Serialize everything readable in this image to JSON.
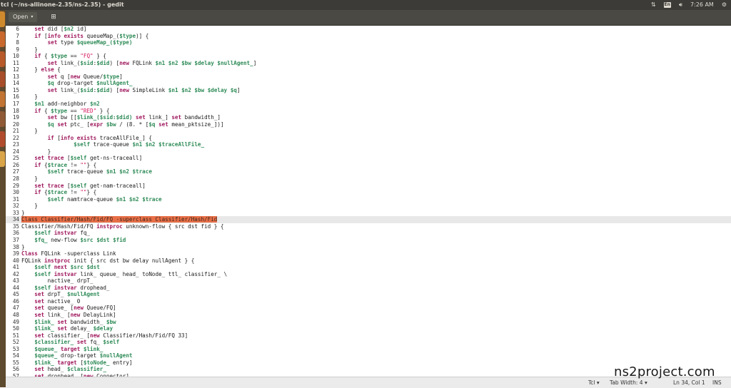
{
  "window": {
    "title": "tcl (~/ns-allinone-2.35/ns-2.35) - gedit",
    "tray": {
      "keyboard_layout": "En",
      "volume_icon": "speaker-icon",
      "time": "7:26 AM"
    }
  },
  "header": {
    "open_label": "Open",
    "new_icon": "new-document-icon"
  },
  "editor": {
    "lines": [
      {
        "n": "6",
        "t": "    set did [$n2 id]"
      },
      {
        "n": "7",
        "t": "    if [info exists queueMap_($type)] {"
      },
      {
        "n": "8",
        "t": "        set type $queueMap_($type)"
      },
      {
        "n": "9",
        "t": "    }"
      },
      {
        "n": "10",
        "t": "    if { $type == \"FQ\" } {"
      },
      {
        "n": "11",
        "t": "        set link_($sid:$did) [new FQLink $n1 $n2 $bw $delay $nullAgent_]"
      },
      {
        "n": "12",
        "t": "    } else {"
      },
      {
        "n": "13",
        "t": "        set q [new Queue/$type]"
      },
      {
        "n": "14",
        "t": "        $q drop-target $nullAgent_"
      },
      {
        "n": "15",
        "t": "        set link_($sid:$did) [new SimpleLink $n1 $n2 $bw $delay $q]"
      },
      {
        "n": "16",
        "t": "    }"
      },
      {
        "n": "17",
        "t": "    $n1 add-neighbor $n2"
      },
      {
        "n": "18",
        "t": "    if { $type == \"RED\" } {"
      },
      {
        "n": "19",
        "t": "        set bw [[$link_($sid:$did) set link_] set bandwidth_]"
      },
      {
        "n": "20",
        "t": "        $q set ptc_ [expr $bw / (8. * [$q set mean_pktsize_])]"
      },
      {
        "n": "21",
        "t": "    }"
      },
      {
        "n": "22",
        "t": "        if [info exists traceAllFile_] {"
      },
      {
        "n": "23",
        "t": "                $self trace-queue $n1 $n2 $traceAllFile_"
      },
      {
        "n": "24",
        "t": "        }"
      },
      {
        "n": "25",
        "t": "    set trace [$self get-ns-traceall]"
      },
      {
        "n": "26",
        "t": "    if {$trace != \"\"} {"
      },
      {
        "n": "27",
        "t": "        $self trace-queue $n1 $n2 $trace"
      },
      {
        "n": "28",
        "t": "    }"
      },
      {
        "n": "29",
        "t": "    set trace [$self get-nam-traceall]"
      },
      {
        "n": "30",
        "t": "    if {$trace != \"\"} {"
      },
      {
        "n": "31",
        "t": "        $self namtrace-queue $n1 $n2 $trace"
      },
      {
        "n": "32",
        "t": "    }"
      },
      {
        "n": "33",
        "t": "}"
      },
      {
        "n": "34",
        "t": "Class Classifier/Hash/Fid/FQ -superclass Classifier/Hash/Fid"
      },
      {
        "n": "35",
        "t": "Classifier/Hash/Fid/FQ instproc unknown-flow { src dst fid } {"
      },
      {
        "n": "36",
        "t": "    $self instvar fq_"
      },
      {
        "n": "37",
        "t": "    $fq_ new-flow $src $dst $fid"
      },
      {
        "n": "38",
        "t": "}"
      },
      {
        "n": "39",
        "t": "Class FQLink -superclass Link"
      },
      {
        "n": "40",
        "t": "FQLink instproc init { src dst bw delay nullAgent } {"
      },
      {
        "n": "41",
        "t": "    $self next $src $dst"
      },
      {
        "n": "42",
        "t": "    $self instvar link_ queue_ head_ toNode_ ttl_ classifier_ \\"
      },
      {
        "n": "43",
        "t": "        nactive_ drpT_"
      },
      {
        "n": "44",
        "t": "    $self instvar drophead_"
      },
      {
        "n": "45",
        "t": "    set drpT_ $nullAgent"
      },
      {
        "n": "46",
        "t": "    set nactive_ 0"
      },
      {
        "n": "47",
        "t": "    set queue_ [new Queue/FQ]"
      },
      {
        "n": "48",
        "t": "    set link_ [new DelayLink]"
      },
      {
        "n": "49",
        "t": "    $link_ set bandwidth_ $bw"
      },
      {
        "n": "50",
        "t": "    $link_ set delay_ $delay"
      },
      {
        "n": "51",
        "t": "    set classifier_ [new Classifier/Hash/Fid/FQ 33]"
      },
      {
        "n": "52",
        "t": "    $classifier_ set fq_ $self"
      },
      {
        "n": "53",
        "t": "    $queue_ target $link_"
      },
      {
        "n": "54",
        "t": "    $queue_ drop-target $nullAgent"
      },
      {
        "n": "55",
        "t": "    $link_ target [$toNode_ entry]"
      },
      {
        "n": "56",
        "t": "    set head_ $classifier_"
      },
      {
        "n": "57",
        "t": "    set drophead_ [new Connector]"
      }
    ],
    "current_line": "34"
  },
  "status": {
    "language": "Tcl",
    "tab_width": "Tab Width: 4",
    "cursor": "Ln 34, Col 1",
    "ins": "INS"
  },
  "watermark": "ns2project.com"
}
